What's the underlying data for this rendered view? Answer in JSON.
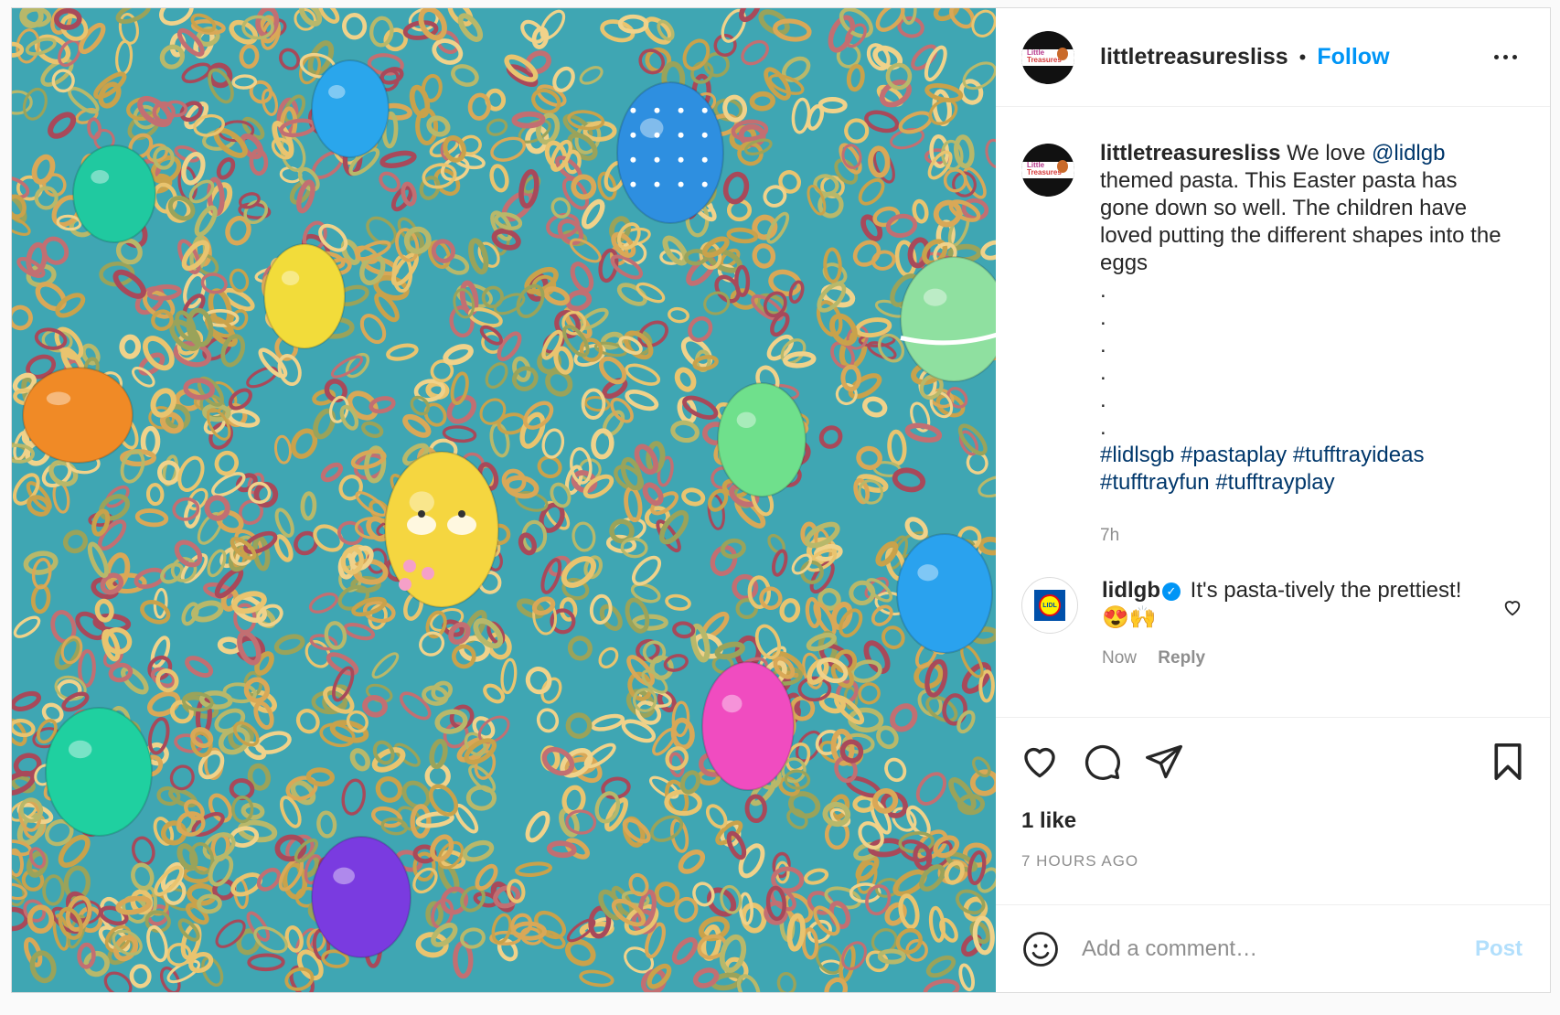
{
  "header": {
    "username": "littletreasuresliss",
    "separator": "•",
    "follow_label": "Follow",
    "avatar_text_1": "Little",
    "avatar_text_2": "Treasures"
  },
  "caption": {
    "username": "littletreasuresliss",
    "text_before": " We love ",
    "mention": "@lidlgb",
    "text_after": " themed pasta. This Easter pasta has gone down so well. The children have loved putting the different shapes into the eggs",
    "dots": [
      ".",
      ".",
      ".",
      ".",
      ".",
      "."
    ],
    "hashtags": [
      "#lidlsgb",
      "#pastaplay",
      "#tufftrayideas",
      "#tufftrayfun",
      "#tufftrayplay"
    ],
    "time": "7h"
  },
  "comment": {
    "username": "lidlgb",
    "verified_mark": "✓",
    "text": " It's pasta-tively the prettiest! 😍🙌",
    "time": "Now",
    "reply_label": "Reply",
    "logo_text": "LIDL"
  },
  "likes": "1 like",
  "timestamp": "7 HOURS AGO",
  "add_comment": {
    "placeholder": "Add a comment…",
    "post_label": "Post"
  },
  "colors": {
    "accent": "#0095f6",
    "link": "#00376b",
    "post_disabled": "#b2dffc",
    "tray": "#3fa6b3"
  },
  "icons": [
    "heart-icon",
    "comment-icon",
    "share-icon",
    "bookmark-icon",
    "emoji-icon",
    "more-icon",
    "verified-icon"
  ]
}
